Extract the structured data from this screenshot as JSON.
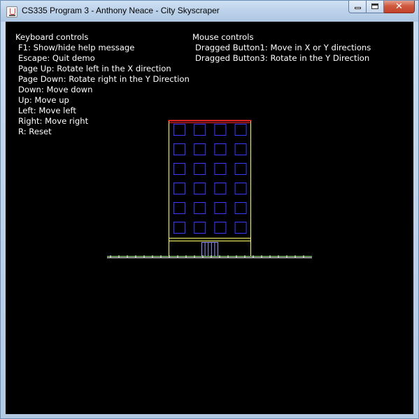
{
  "window": {
    "title": "CS335 Program 3 - Anthony Neace - City Skyscraper",
    "app_icon": "java-icon",
    "buttons": {
      "minimize": "minimize-icon",
      "maximize": "maximize-icon",
      "close": "close-icon",
      "close_glyph": "✕"
    }
  },
  "help": {
    "keyboard": {
      "heading": "Keyboard controls",
      "items": [
        "F1: Show/hide help message",
        "Escape: Quit demo",
        "Page Up: Rotate left in the X direction",
        "Page Down: Rotate right in the Y Direction",
        "Down: Move down",
        "Up: Move up",
        "Left: Move left",
        "Right: Move right",
        "R: Reset"
      ]
    },
    "mouse": {
      "heading": "Mouse controls",
      "items": [
        "Dragged Button1: Move in X or Y directions",
        "Dragged Button3: Rotate in the Y Direction"
      ]
    }
  },
  "scene": {
    "background": "#000000",
    "window_rows": 6,
    "window_cols": 4,
    "colors": {
      "roof": "#ff2a2a",
      "walls": "#ffff66",
      "windows": "#3b3bff",
      "door": "#9a9aff",
      "ground": "#aaff88",
      "street": "#ffffff"
    }
  }
}
